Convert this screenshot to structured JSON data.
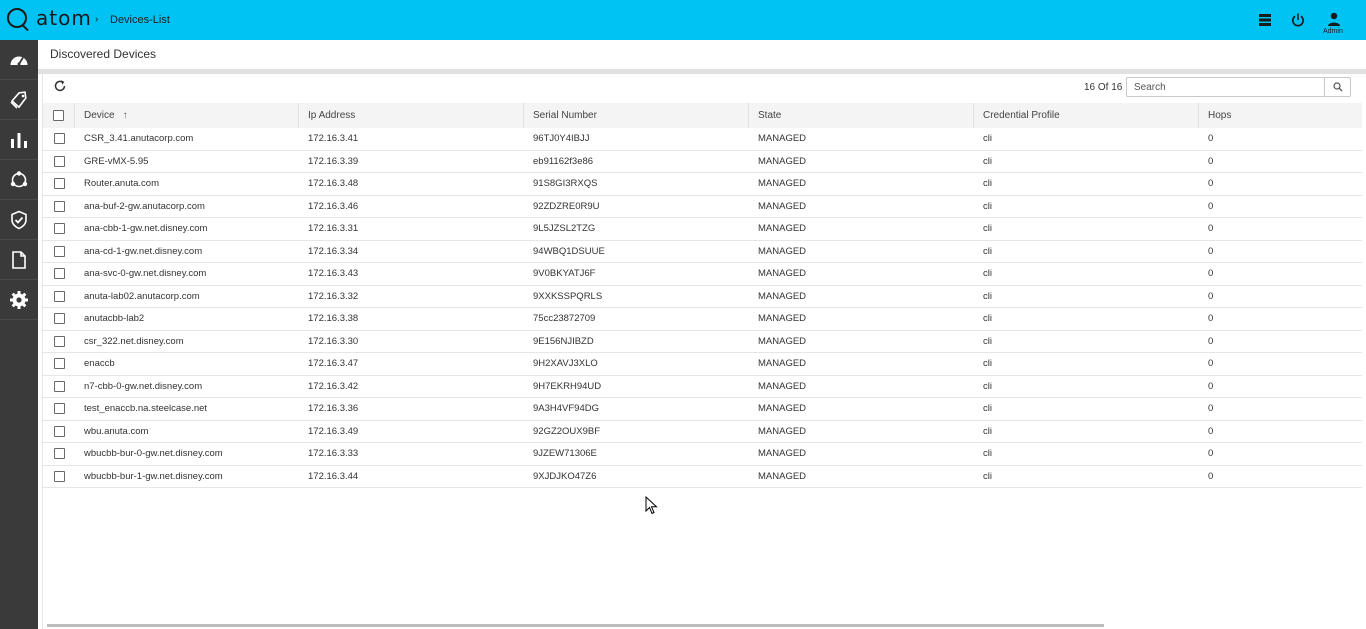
{
  "app": {
    "logo_text": "atom",
    "breadcrumb_sep": "›",
    "breadcrumb": "Devices-List"
  },
  "header": {
    "user_label": "Admin"
  },
  "sidebar": {
    "items": [
      {
        "name": "dashboard",
        "icon": "speedometer-icon"
      },
      {
        "name": "devices",
        "icon": "tag-icon"
      },
      {
        "name": "analytics",
        "icon": "bar-chart-icon"
      },
      {
        "name": "network",
        "icon": "topology-icon"
      },
      {
        "name": "compliance",
        "icon": "shield-check-icon"
      },
      {
        "name": "reports",
        "icon": "document-icon"
      },
      {
        "name": "settings",
        "icon": "gear-icon"
      }
    ]
  },
  "page": {
    "title": "Discovered Devices"
  },
  "toolbar": {
    "count": "16 Of 16",
    "search_placeholder": "Search",
    "search_value": ""
  },
  "table": {
    "columns": [
      "Device",
      "Ip Address",
      "Serial Number",
      "State",
      "Credential Profile",
      "Hops"
    ],
    "sorted_column": "Device",
    "rows": [
      [
        "CSR_3.41.anutacorp.com",
        "172.16.3.41",
        "96TJ0Y4IBJJ",
        "MANAGED",
        "cli",
        "0"
      ],
      [
        "GRE-vMX-5.95",
        "172.16.3.39",
        "eb91162f3e86",
        "MANAGED",
        "cli",
        "0"
      ],
      [
        "Router.anuta.com",
        "172.16.3.48",
        "91S8GI3RXQS",
        "MANAGED",
        "cli",
        "0"
      ],
      [
        "ana-buf-2-gw.anutacorp.com",
        "172.16.3.46",
        "92ZDZRE0R9U",
        "MANAGED",
        "cli",
        "0"
      ],
      [
        "ana-cbb-1-gw.net.disney.com",
        "172.16.3.31",
        "9L5JZSL2TZG",
        "MANAGED",
        "cli",
        "0"
      ],
      [
        "ana-cd-1-gw.net.disney.com",
        "172.16.3.34",
        "94WBQ1DSUUE",
        "MANAGED",
        "cli",
        "0"
      ],
      [
        "ana-svc-0-gw.net.disney.com",
        "172.16.3.43",
        "9V0BKYATJ6F",
        "MANAGED",
        "cli",
        "0"
      ],
      [
        "anuta-lab02.anutacorp.com",
        "172.16.3.32",
        "9XXKSSPQRLS",
        "MANAGED",
        "cli",
        "0"
      ],
      [
        "anutacbb-lab2",
        "172.16.3.38",
        "75cc23872709",
        "MANAGED",
        "cli",
        "0"
      ],
      [
        "csr_322.net.disney.com",
        "172.16.3.30",
        "9E156NJIBZD",
        "MANAGED",
        "cli",
        "0"
      ],
      [
        "enaccb",
        "172.16.3.47",
        "9H2XAVJ3XLO",
        "MANAGED",
        "cli",
        "0"
      ],
      [
        "n7-cbb-0-gw.net.disney.com",
        "172.16.3.42",
        "9H7EKRH94UD",
        "MANAGED",
        "cli",
        "0"
      ],
      [
        "test_enaccb.na.steelcase.net",
        "172.16.3.36",
        "9A3H4VF94DG",
        "MANAGED",
        "cli",
        "0"
      ],
      [
        "wbu.anuta.com",
        "172.16.3.49",
        "92GZ2OUX9BF",
        "MANAGED",
        "cli",
        "0"
      ],
      [
        "wbucbb-bur-0-gw.net.disney.com",
        "172.16.3.33",
        "9JZEW71306E",
        "MANAGED",
        "cli",
        "0"
      ],
      [
        "wbucbb-bur-1-gw.net.disney.com",
        "172.16.3.44",
        "9XJDJKO47Z6",
        "MANAGED",
        "cli",
        "0"
      ]
    ]
  },
  "colors": {
    "topbar": "#00c2f3",
    "sidebar": "#3a3a3a",
    "header_row": "#f4f4f4"
  }
}
